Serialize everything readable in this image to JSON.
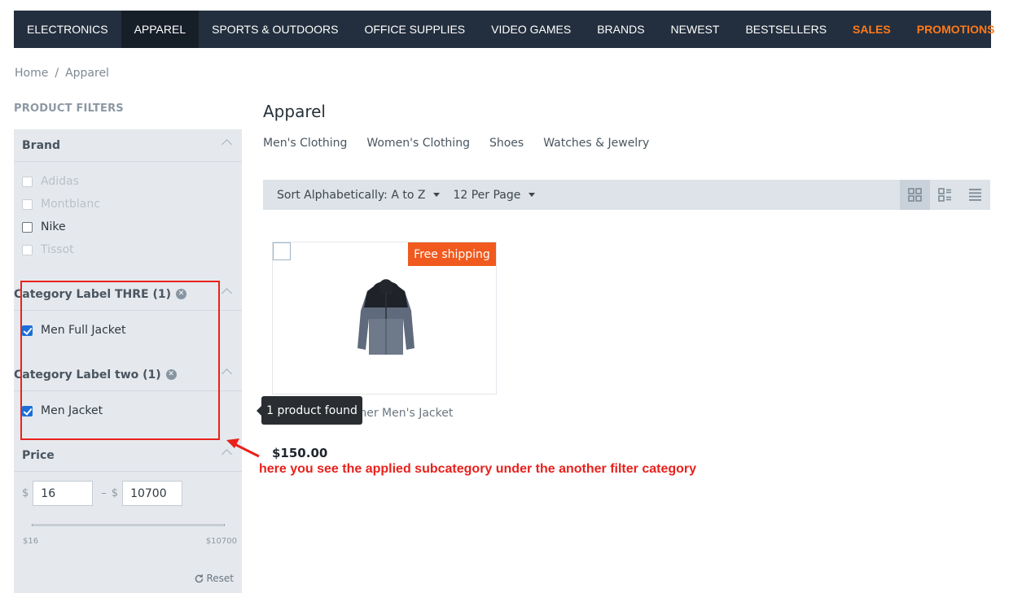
{
  "nav": {
    "items": [
      {
        "label": "ELECTRONICS"
      },
      {
        "label": "APPAREL"
      },
      {
        "label": "SPORTS & OUTDOORS"
      },
      {
        "label": "OFFICE SUPPLIES"
      },
      {
        "label": "VIDEO GAMES"
      },
      {
        "label": "BRANDS"
      },
      {
        "label": "NEWEST"
      },
      {
        "label": "BESTSELLERS"
      },
      {
        "label": "SALES"
      },
      {
        "label": "PROMOTIONS"
      }
    ],
    "active": "APPAREL",
    "highlight_color": "#ff7a1a"
  },
  "breadcrumb": {
    "home": "Home",
    "separator": "/",
    "current": "Apparel"
  },
  "filters": {
    "title": "PRODUCT FILTERS",
    "brand": {
      "heading": "Brand",
      "options": [
        {
          "label": "Adidas",
          "state": "disabled"
        },
        {
          "label": "Montblanc",
          "state": "disabled"
        },
        {
          "label": "Nike",
          "state": "unchecked"
        },
        {
          "label": "Tissot",
          "state": "disabled"
        }
      ]
    },
    "category_three": {
      "heading": "Category Label THRE (1)",
      "option": "Men Full Jacket",
      "checked": true
    },
    "category_two": {
      "heading": "Category Label two (1)",
      "option": "Men Jacket",
      "checked": true
    },
    "price": {
      "heading": "Price",
      "currency": "$",
      "separator": "–",
      "min_value": "16",
      "max_value": "10700",
      "min_label": "$16",
      "max_label": "$10700",
      "reset_label": "Reset"
    }
  },
  "main": {
    "title": "Apparel",
    "subcategories": [
      "Men's Clothing",
      "Women's Clothing",
      "Shoes",
      "Watches & Jewelry"
    ],
    "sort_label": "Sort Alphabetically: A to Z",
    "per_page_label": "12 Per Page",
    "view_modes": [
      "grid-icon",
      "list-grid-icon",
      "list-icon"
    ]
  },
  "product": {
    "badge": "Free shipping",
    "name": "Nike Super Runner Men's Jacket",
    "price": "$150.00",
    "badge_color": "#f05a1e"
  },
  "tooltip": {
    "text": "1 product found"
  },
  "annotation": {
    "text": "here you see the applied subcategory under the another filter category",
    "color": "#e8211c"
  }
}
